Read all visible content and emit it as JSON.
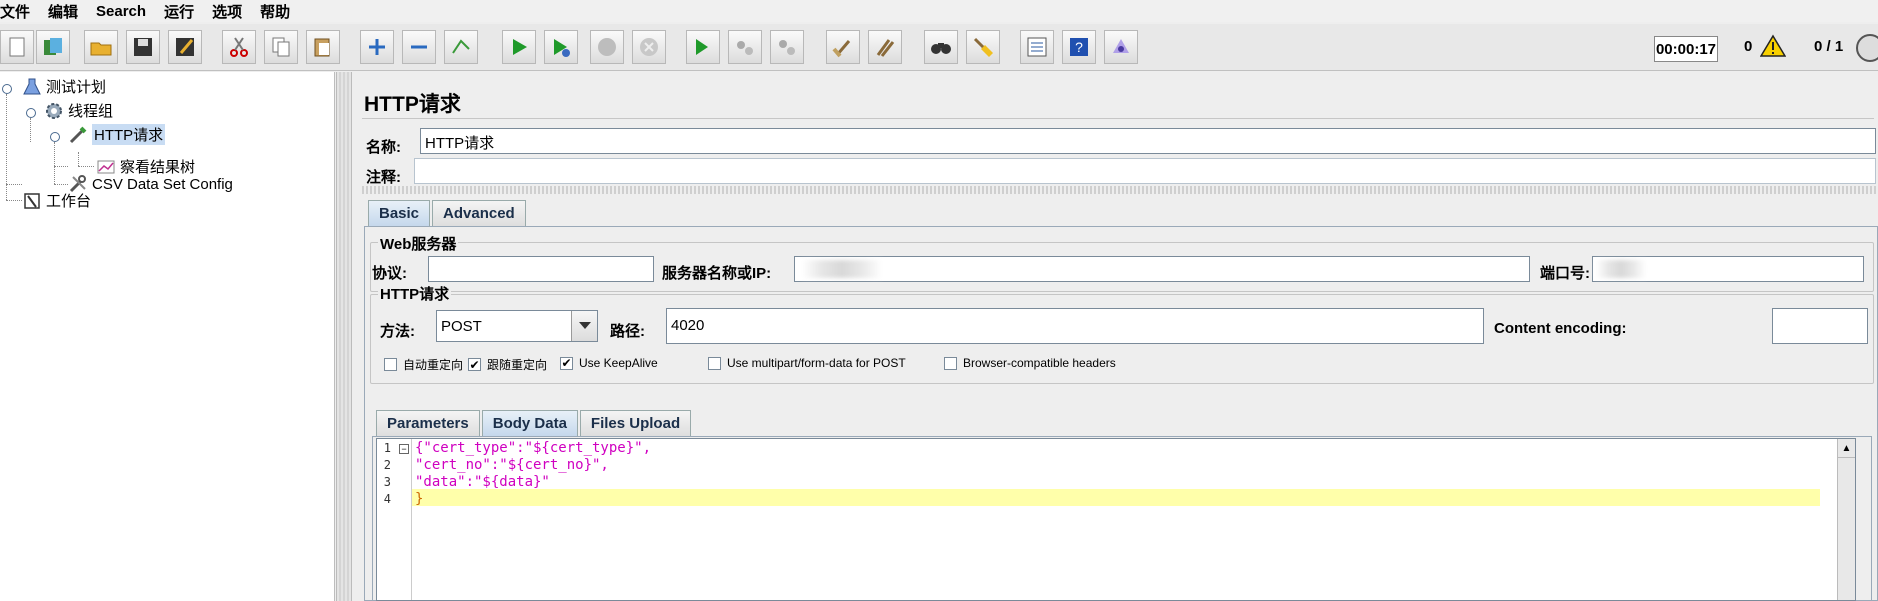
{
  "menu": [
    "文件",
    "编辑",
    "Search",
    "运行",
    "选项",
    "帮助"
  ],
  "toolbar": {
    "buttons": [
      "new-icon",
      "templates-icon",
      "open-icon",
      "save-icon",
      "save-as-icon",
      "cut-icon",
      "copy-icon",
      "paste-icon",
      "expand-icon",
      "collapse-icon",
      "toggle-icon",
      "start-icon",
      "start-no-pause-icon",
      "stop-icon",
      "shutdown-icon",
      "remote-start-icon",
      "remote-stop-icon",
      "remote-shutdown-icon",
      "clear-icon",
      "clear-all-icon",
      "search-icon",
      "reset-search-icon",
      "function-helper-icon",
      "help-icon",
      "log-viewer-icon"
    ],
    "timer": "00:00:17",
    "error_count": "0",
    "threads": "0 / 1"
  },
  "tree": {
    "nodes": [
      "测试计划",
      "线程组",
      "HTTP请求",
      "察看结果树",
      "CSV Data Set Config",
      "工作台"
    ]
  },
  "panel": {
    "title": "HTTP请求",
    "name_label": "名称:",
    "name_value": "HTTP请求",
    "comment_label": "注释:",
    "comment_value": "",
    "tabs": [
      "Basic",
      "Advanced"
    ],
    "web_server": {
      "legend": "Web服务器",
      "protocol_label": "协议:",
      "protocol_value": "",
      "server_label": "服务器名称或IP:",
      "port_label": "端口号:"
    },
    "http_request": {
      "legend": "HTTP请求",
      "method_label": "方法:",
      "method_value": "POST",
      "path_label": "路径:",
      "path_value": "4020",
      "encoding_label": "Content encoding:",
      "encoding_value": ""
    },
    "checkboxes": [
      {
        "label": "自动重定向",
        "checked": false
      },
      {
        "label": "跟随重定向",
        "checked": true
      },
      {
        "label": "Use KeepAlive",
        "checked": true
      },
      {
        "label": "Use multipart/form-data for POST",
        "checked": false
      },
      {
        "label": "Browser-compatible headers",
        "checked": false
      }
    ],
    "subtabs": [
      "Parameters",
      "Body Data",
      "Files Upload"
    ],
    "body_lines": [
      "{\"cert_type\":\"${cert_type}\",",
      "\"cert_no\":\"${cert_no}\",",
      "\"data\":\"${data}\"",
      "}"
    ],
    "line_numbers": [
      "1",
      "2",
      "3",
      "4"
    ]
  }
}
